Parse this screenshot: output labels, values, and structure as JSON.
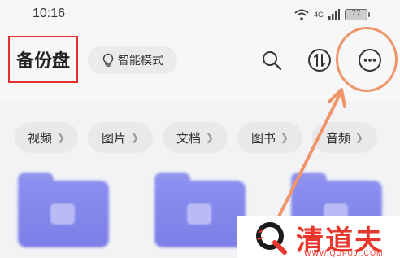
{
  "status_bar": {
    "time": "10:16",
    "network": "4G",
    "battery": "77"
  },
  "header": {
    "title": "备份盘",
    "smart_mode_label": "智能模式",
    "icons": [
      "bulb-icon",
      "search-icon",
      "transfer-icon",
      "more-icon"
    ]
  },
  "categories": [
    {
      "label": "视频"
    },
    {
      "label": "图片"
    },
    {
      "label": "文档"
    },
    {
      "label": "图书"
    },
    {
      "label": "音频"
    }
  ],
  "watermark": {
    "brand": "清道夫",
    "url": "WWW.QDFUJI.COM"
  },
  "colors": {
    "highlight_red": "#e53030",
    "annotation_orange": "#f0956a",
    "folder": "#8b8ff0",
    "brand_red": "#e8372c"
  }
}
